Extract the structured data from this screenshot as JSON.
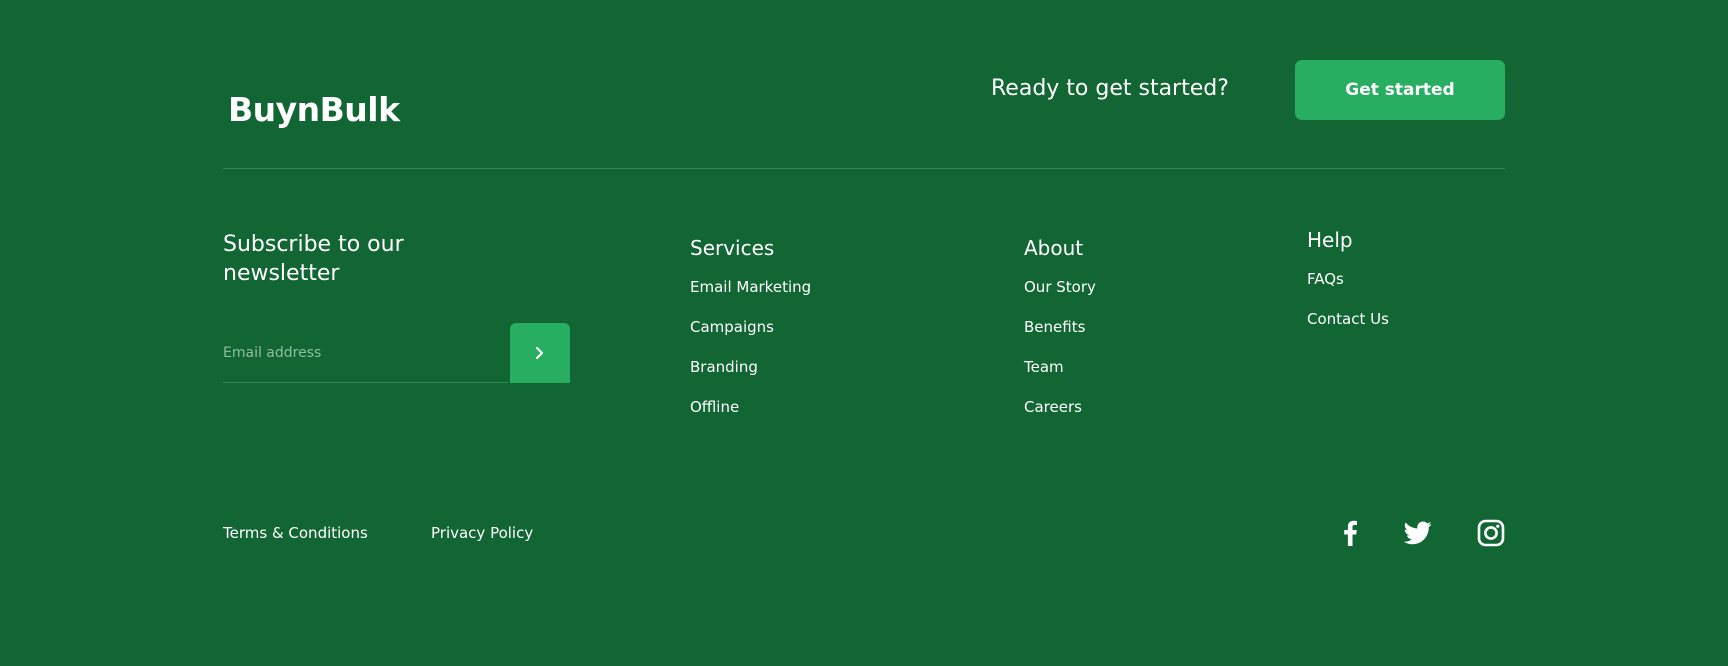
{
  "header": {
    "brand": "BuynBulk",
    "prompt": "Ready to get started?",
    "cta_label": "Get started"
  },
  "newsletter": {
    "title": "Subscribe to our newsletter",
    "email_placeholder": "Email address",
    "submit_icon": "chevron-right-icon"
  },
  "columns": {
    "services": {
      "heading": "Services",
      "links": [
        "Email Marketing",
        "Campaigns",
        "Branding",
        "Offline"
      ]
    },
    "about": {
      "heading": "About",
      "links": [
        "Our Story",
        "Benefits",
        "Team",
        "Careers"
      ]
    },
    "help": {
      "heading": "Help",
      "links": [
        "FAQs",
        "Contact Us"
      ]
    }
  },
  "legal": {
    "terms": "Terms & Conditions",
    "privacy": "Privacy Policy"
  },
  "social": {
    "icons": [
      "facebook-icon",
      "twitter-icon",
      "instagram-icon"
    ]
  },
  "colors": {
    "background": "#116633",
    "accent": "#27ae60",
    "text": "#ffffff",
    "placeholder": "#8fbd9f",
    "divider": "#2e8a4f"
  }
}
